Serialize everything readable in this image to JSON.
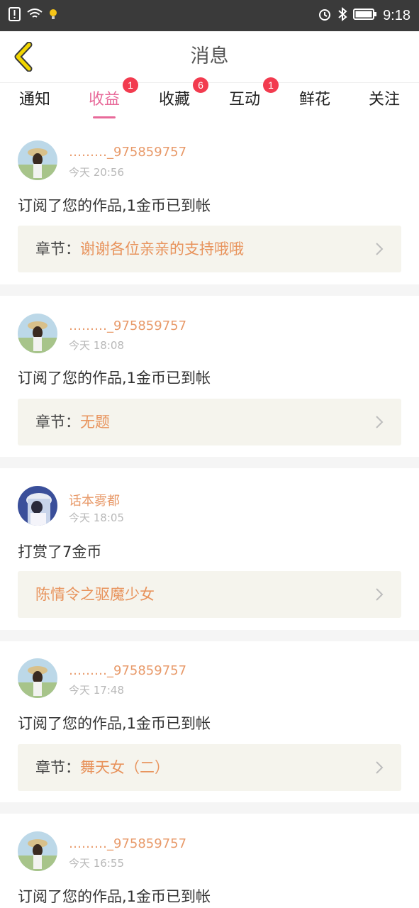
{
  "status_bar": {
    "time": "9:18"
  },
  "header": {
    "title": "消息"
  },
  "tabs": [
    {
      "label": "通知",
      "badge": ""
    },
    {
      "label": "收益",
      "badge": "1",
      "active": true
    },
    {
      "label": "收藏",
      "badge": "6"
    },
    {
      "label": "互动",
      "badge": "1"
    },
    {
      "label": "鲜花",
      "badge": ""
    },
    {
      "label": "关注",
      "badge": ""
    }
  ],
  "messages": [
    {
      "user": "………_975859757",
      "time": "今天 20:56",
      "text": "订阅了您的作品,1金币已到帐",
      "chapter_prefix": "章节：",
      "chapter": "谢谢各位亲亲的支持哦哦"
    },
    {
      "user": "………_975859757",
      "time": "今天 18:08",
      "text": "订阅了您的作品,1金币已到帐",
      "chapter_prefix": "章节：",
      "chapter": "无题"
    },
    {
      "user": "话本雾都",
      "time": "今天 18:05",
      "text": "打赏了7金币",
      "chapter_prefix": "",
      "chapter": "陈情令之驱魔少女"
    },
    {
      "user": "………_975859757",
      "time": "今天 17:48",
      "text": "订阅了您的作品,1金币已到帐",
      "chapter_prefix": "章节：",
      "chapter": "舞天女（二）"
    },
    {
      "user": "………_975859757",
      "time": "今天 16:55",
      "text": "订阅了您的作品,1金币已到帐",
      "chapter_prefix": "",
      "chapter": ""
    }
  ],
  "colors": {
    "accent": "#e86a9a",
    "name": "#e89a6a",
    "badge": "#f23b4f",
    "back_arrow": "#f2d600"
  }
}
